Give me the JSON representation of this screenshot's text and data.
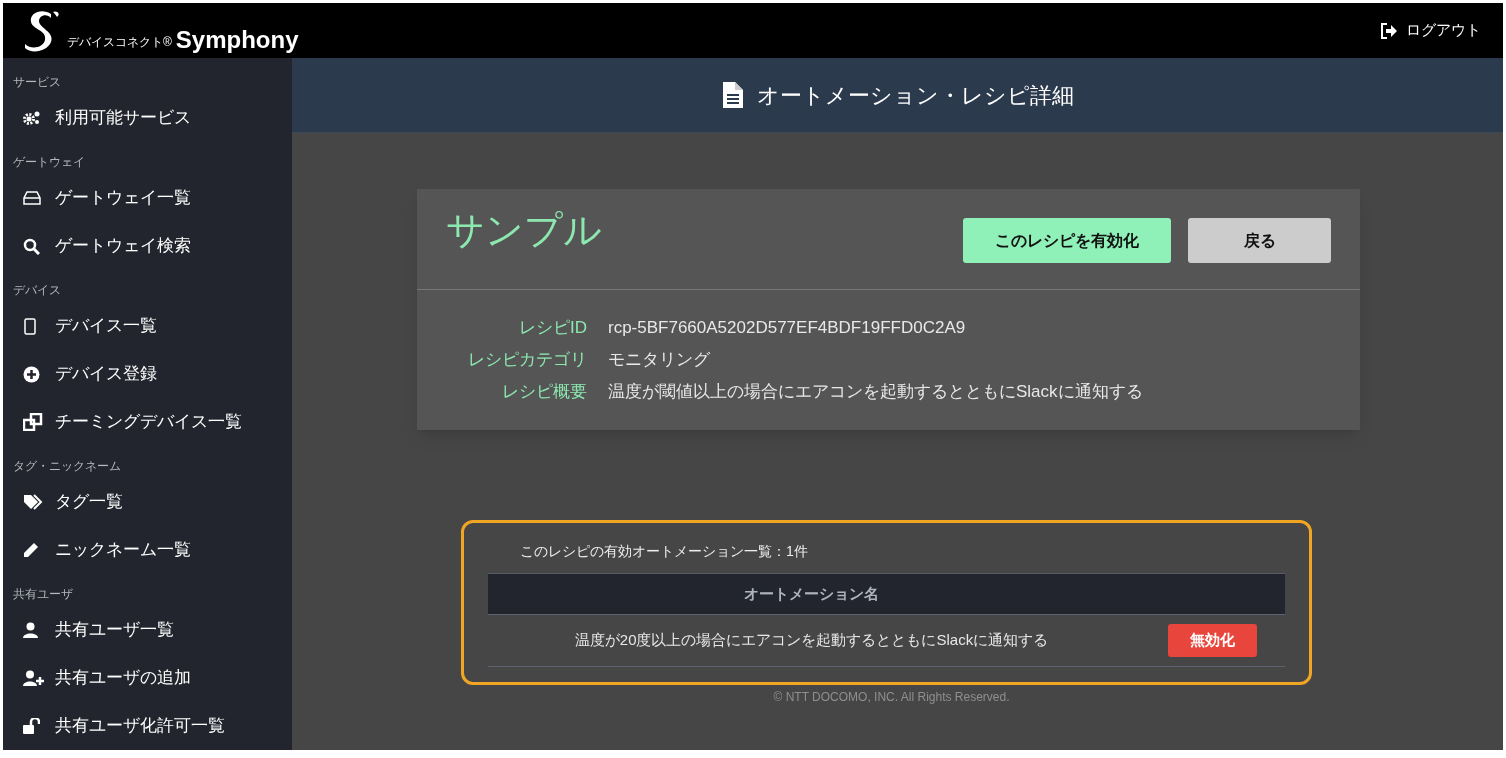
{
  "header": {
    "brand_small": "デバイスコネクト®",
    "brand": "Symphony",
    "logout": "ログアウト"
  },
  "sidebar": {
    "sections": [
      {
        "label": "サービス",
        "items": [
          {
            "label": "利用可能サービス"
          }
        ]
      },
      {
        "label": "ゲートウェイ",
        "items": [
          {
            "label": "ゲートウェイ一覧"
          },
          {
            "label": "ゲートウェイ検索"
          }
        ]
      },
      {
        "label": "デバイス",
        "items": [
          {
            "label": "デバイス一覧"
          },
          {
            "label": "デバイス登録"
          },
          {
            "label": "チーミングデバイス一覧"
          }
        ]
      },
      {
        "label": "タグ・ニックネーム",
        "items": [
          {
            "label": "タグ一覧"
          },
          {
            "label": "ニックネーム一覧"
          }
        ]
      },
      {
        "label": "共有ユーザ",
        "items": [
          {
            "label": "共有ユーザ一覧"
          },
          {
            "label": "共有ユーザの追加"
          },
          {
            "label": "共有ユーザ化許可一覧"
          }
        ]
      }
    ]
  },
  "page_title": "オートメーション・レシピ詳細",
  "recipe": {
    "name": "サンプル",
    "enable_button": "このレシピを有効化",
    "back_button": "戻る",
    "fields": [
      {
        "label": "レシピID",
        "value": "rcp-5BF7660A5202D577EF4BDF19FFD0C2A9"
      },
      {
        "label": "レシピカテゴリ",
        "value": "モニタリング"
      },
      {
        "label": "レシピ概要",
        "value": "温度が閾値以上の場合にエアコンを起動するとともにSlackに通知する"
      }
    ]
  },
  "automations": {
    "caption": "このレシピの有効オートメーション一覧：1件",
    "columns": [
      "オートメーション名"
    ],
    "rows": [
      {
        "name": "温度が20度以上の場合にエアコンを起動するとともにSlackに通知する",
        "action": "無効化"
      }
    ]
  },
  "footer": "© NTT DOCOMO, INC. All Rights Reserved."
}
